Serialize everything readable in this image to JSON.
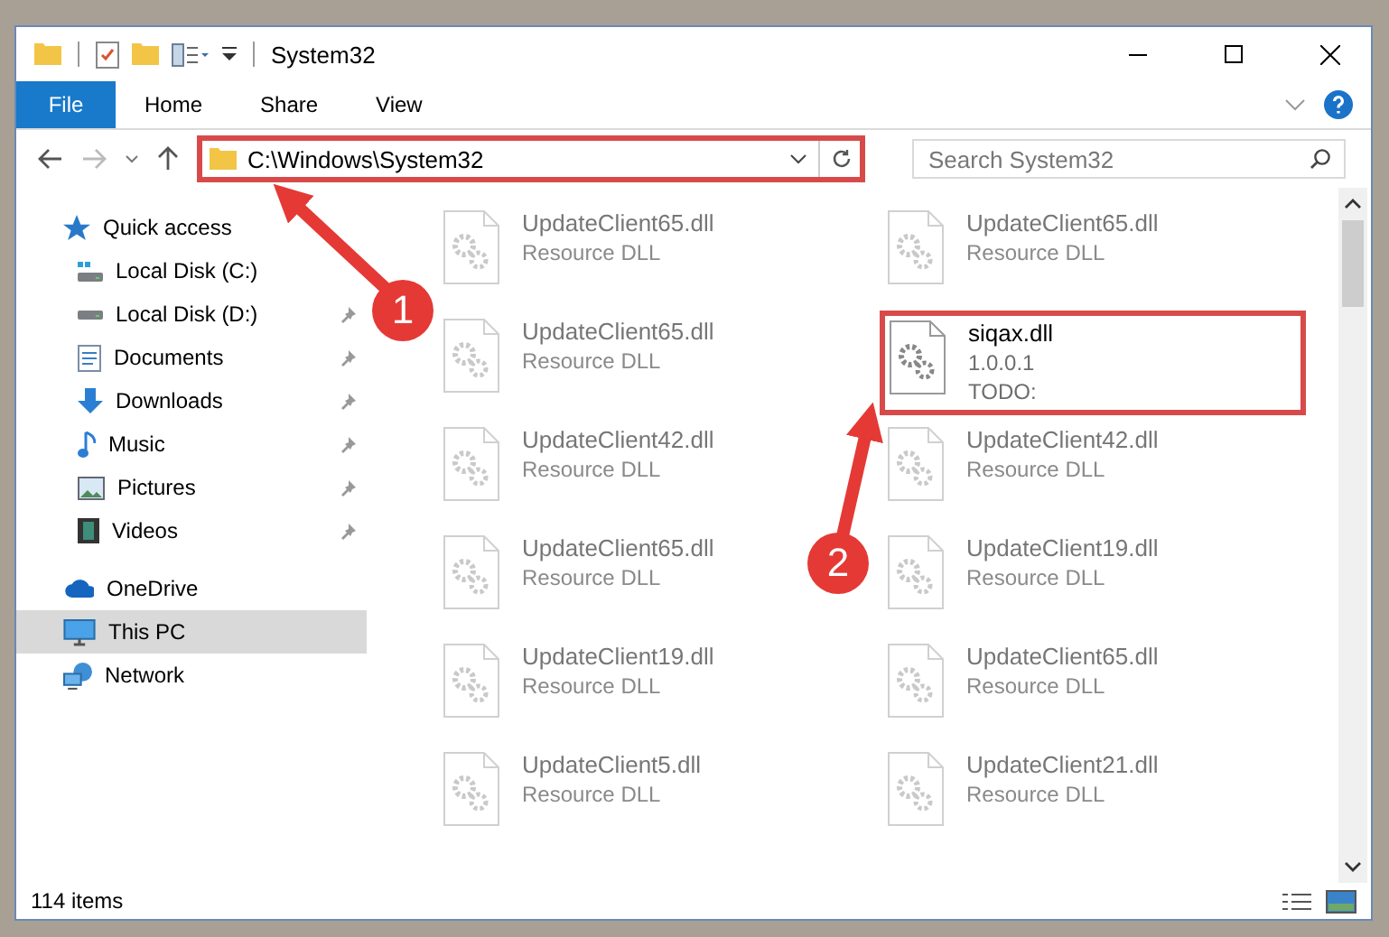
{
  "window": {
    "title": "System32"
  },
  "ribbon": {
    "tabs": [
      {
        "label": "File",
        "selected": true
      },
      {
        "label": "Home",
        "selected": false
      },
      {
        "label": "Share",
        "selected": false
      },
      {
        "label": "View",
        "selected": false
      }
    ]
  },
  "address_bar": {
    "path": "C:\\Windows\\System32",
    "highlighted": true
  },
  "search": {
    "placeholder": "Search System32"
  },
  "sidebar": {
    "items": [
      {
        "label": "Quick access",
        "selected": false,
        "children": [
          {
            "label": "Local Disk (C:)",
            "pinned": false
          },
          {
            "label": "Local Disk (D:)",
            "pinned": true
          },
          {
            "label": "Documents",
            "pinned": true
          },
          {
            "label": "Downloads",
            "pinned": true
          },
          {
            "label": "Music",
            "pinned": true
          },
          {
            "label": "Pictures",
            "pinned": true
          },
          {
            "label": "Videos",
            "pinned": true
          }
        ]
      },
      {
        "label": "OneDrive",
        "selected": false
      },
      {
        "label": "This PC",
        "selected": true
      },
      {
        "label": "Network",
        "selected": false
      }
    ]
  },
  "files": [
    {
      "name": "UpdateClient65.dll",
      "details": [
        "Resource DLL"
      ],
      "dimmed": true,
      "highlighted": false
    },
    {
      "name": "UpdateClient65.dll",
      "details": [
        "Resource DLL"
      ],
      "dimmed": true,
      "highlighted": false
    },
    {
      "name": "UpdateClient65.dll",
      "details": [
        "Resource DLL"
      ],
      "dimmed": true,
      "highlighted": false
    },
    {
      "name": "siqax.dll",
      "details": [
        "1.0.0.1",
        "TODO:"
      ],
      "dimmed": false,
      "highlighted": true
    },
    {
      "name": "UpdateClient42.dll",
      "details": [
        "Resource DLL"
      ],
      "dimmed": true,
      "highlighted": false
    },
    {
      "name": "UpdateClient42.dll",
      "details": [
        "Resource DLL"
      ],
      "dimmed": true,
      "highlighted": false
    },
    {
      "name": "UpdateClient65.dll",
      "details": [
        "Resource DLL"
      ],
      "dimmed": true,
      "highlighted": false
    },
    {
      "name": "UpdateClient19.dll",
      "details": [
        "Resource DLL"
      ],
      "dimmed": true,
      "highlighted": false
    },
    {
      "name": "UpdateClient19.dll",
      "details": [
        "Resource DLL"
      ],
      "dimmed": true,
      "highlighted": false
    },
    {
      "name": "UpdateClient65.dll",
      "details": [
        "Resource DLL"
      ],
      "dimmed": true,
      "highlighted": false
    },
    {
      "name": "UpdateClient5.dll",
      "details": [
        "Resource DLL"
      ],
      "dimmed": true,
      "highlighted": false
    },
    {
      "name": "UpdateClient21.dll",
      "details": [
        "Resource DLL"
      ],
      "dimmed": true,
      "highlighted": false
    }
  ],
  "status_bar": {
    "item_count": "114 items"
  },
  "annotations": [
    {
      "label": "1"
    },
    {
      "label": "2"
    }
  ]
}
